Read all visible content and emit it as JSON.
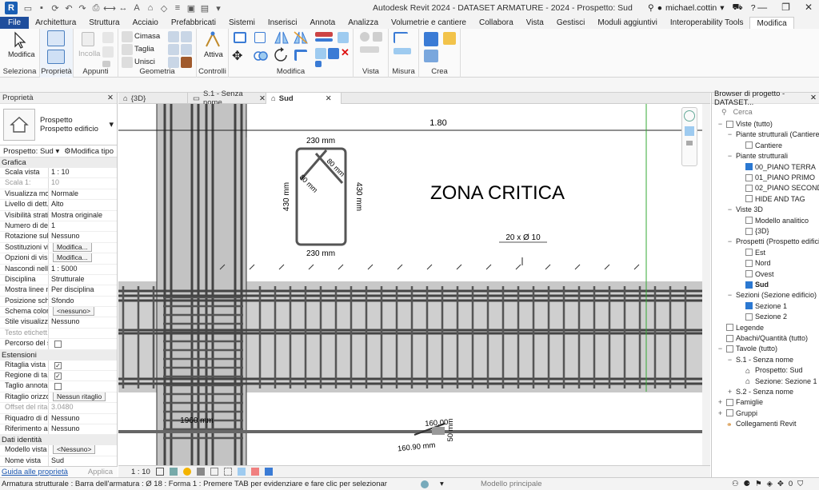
{
  "app": {
    "logo": "R",
    "title": "Autodesk Revit 2024 - DATASET ARMATURE - 2024 - Prospetto: Sud",
    "user": "michael.cottin"
  },
  "tabs": [
    "File",
    "Architettura",
    "Struttura",
    "Acciaio",
    "Prefabbricati",
    "Sistemi",
    "Inserisci",
    "Annota",
    "Analizza",
    "Volumetrie e cantiere",
    "Collabora",
    "Vista",
    "Gestisci",
    "Moduli aggiuntivi",
    "Interoperability Tools",
    "Modifica"
  ],
  "ribbon": {
    "panels": [
      "Seleziona",
      "Proprietà",
      "Appunti",
      "Geometria",
      "Controlli",
      "Modifica",
      "Vista",
      "Misura",
      "Crea"
    ],
    "modifica_label": "Modifica",
    "incolla_label": "Incolla",
    "cimasa_label": "Cimasa",
    "taglia_label": "Taglia",
    "unisci_label": "Unisci",
    "attiva_label": "Attiva"
  },
  "properties": {
    "header": "Proprietà",
    "type_line1": "Prospetto",
    "type_line2": "Prospetto edificio",
    "filter_label": "Prospetto: Sud",
    "edit_type": "Modifica tipo",
    "groups": {
      "grafica": "Grafica",
      "estensioni": "Estensioni",
      "dati_identita": "Dati identità"
    },
    "rows": [
      {
        "k": "Scala vista",
        "v": "1 : 10"
      },
      {
        "k": "Scala 1:",
        "v": "10"
      },
      {
        "k": "Visualizza mo...",
        "v": "Normale"
      },
      {
        "k": "Livello di dett...",
        "v": "Alto"
      },
      {
        "k": "Visibilità strati...",
        "v": "Mostra originale"
      },
      {
        "k": "Numero di de...",
        "v": "1"
      },
      {
        "k": "Rotazione sull...",
        "v": "Nessuno"
      },
      {
        "k": "Sostituzioni vi...",
        "v": "Modifica..."
      },
      {
        "k": "Opzioni di vis...",
        "v": "Modifica..."
      },
      {
        "k": "Nascondi nell...",
        "v": "1 : 5000"
      },
      {
        "k": "Disciplina",
        "v": "Strutturale"
      },
      {
        "k": "Mostra linee n...",
        "v": "Per disciplina"
      },
      {
        "k": "Posizione sch...",
        "v": "Sfondo"
      },
      {
        "k": "Schema colori",
        "v": "<nessuno>"
      },
      {
        "k": "Stile visualizza...",
        "v": "Nessuno"
      },
      {
        "k": "Testo etichett...",
        "v": ""
      },
      {
        "k": "Percorso del s...",
        "v": ""
      }
    ],
    "ext_rows": [
      {
        "k": "Ritaglia vista",
        "v": ""
      },
      {
        "k": "Regione di ta...",
        "v": ""
      },
      {
        "k": "Taglio annota...",
        "v": ""
      },
      {
        "k": "Ritaglio orizzo...",
        "v": "Nessun ritaglio"
      },
      {
        "k": "Offset del rita...",
        "v": "3.0480"
      },
      {
        "k": "Riquadro di d...",
        "v": "Nessuno"
      },
      {
        "k": "Riferimento as...",
        "v": "Nessuno"
      }
    ],
    "id_rows": [
      {
        "k": "Modello vista",
        "v": "<Nessuno>"
      },
      {
        "k": "Nome vista",
        "v": "Sud"
      }
    ],
    "help_link": "Guida alle proprietà",
    "apply": "Applica"
  },
  "view_tabs": [
    "{3D}",
    "S.1 - Senza nome",
    "Sud"
  ],
  "drawing": {
    "dim_top": "1.80",
    "section_top": "230 mm",
    "section_bottom": "230 mm",
    "section_left": "430 mm",
    "section_right": "430 mm",
    "hook_a": "80 mm",
    "hook_b": "80 mm",
    "zone_title": "ZONA CRITICA",
    "rebar_tag": "20 x Ø 10",
    "len_label": "1960 mm",
    "bend_a": "160.00",
    "bend_b": "160.90 mm",
    "bend_c": "50 mm"
  },
  "view_scale": "1 : 10",
  "browser": {
    "header": "Browser di progetto - DATASET...",
    "search_placeholder": "Cerca",
    "items": [
      {
        "t": "Viste (tutto)",
        "lvl": 0,
        "tog": "−",
        "box": "view"
      },
      {
        "t": "Piante strutturali (Cantiere)",
        "lvl": 1,
        "tog": "−"
      },
      {
        "t": "Cantiere",
        "lvl": 2,
        "box": "b"
      },
      {
        "t": "Piante strutturali",
        "lvl": 1,
        "tog": "−"
      },
      {
        "t": "00_PIANO TERRA",
        "lvl": 2,
        "box": "sel"
      },
      {
        "t": "01_PIANO PRIMO",
        "lvl": 2,
        "box": "b"
      },
      {
        "t": "02_PIANO SECONDO",
        "lvl": 2,
        "box": "b"
      },
      {
        "t": "HIDE AND TAG",
        "lvl": 2,
        "box": "b"
      },
      {
        "t": "Viste 3D",
        "lvl": 1,
        "tog": "−"
      },
      {
        "t": "Modello analitico",
        "lvl": 2,
        "box": "b"
      },
      {
        "t": "{3D}",
        "lvl": 2,
        "box": "b"
      },
      {
        "t": "Prospetti (Prospetto edificio)",
        "lvl": 1,
        "tog": "−"
      },
      {
        "t": "Est",
        "lvl": 2,
        "box": "b"
      },
      {
        "t": "Nord",
        "lvl": 2,
        "box": "b"
      },
      {
        "t": "Ovest",
        "lvl": 2,
        "box": "b"
      },
      {
        "t": "Sud",
        "lvl": 2,
        "box": "sel",
        "bold": true
      },
      {
        "t": "Sezioni (Sezione edificio)",
        "lvl": 1,
        "tog": "−"
      },
      {
        "t": "Sezione 1",
        "lvl": 2,
        "box": "sel"
      },
      {
        "t": "Sezione 2",
        "lvl": 2,
        "box": "b"
      },
      {
        "t": "Legende",
        "lvl": 0,
        "box": "b"
      },
      {
        "t": "Abachi/Quantità (tutto)",
        "lvl": 0,
        "box": "b"
      },
      {
        "t": "Tavole (tutto)",
        "lvl": 0,
        "tog": "−",
        "box": "b"
      },
      {
        "t": "S.1 - Senza nome",
        "lvl": 1,
        "tog": "−"
      },
      {
        "t": "Prospetto: Sud",
        "lvl": 2,
        "box": "house"
      },
      {
        "t": "Sezione: Sezione 1",
        "lvl": 2,
        "box": "house"
      },
      {
        "t": "S.2 - Senza nome",
        "lvl": 1,
        "tog": "+"
      },
      {
        "t": "Famiglie",
        "lvl": 0,
        "tog": "+",
        "box": "b"
      },
      {
        "t": "Gruppi",
        "lvl": 0,
        "tog": "+",
        "box": "b"
      },
      {
        "t": "Collegamenti Revit",
        "lvl": 0,
        "box": "link"
      }
    ]
  },
  "status": {
    "message": "Armatura strutturale : Barra dell'armatura : Ø 18 : Forma 1 : Premere TAB per evidenziare e fare clic per selezionar",
    "model": "Modello principale",
    "filter_count": "0"
  }
}
